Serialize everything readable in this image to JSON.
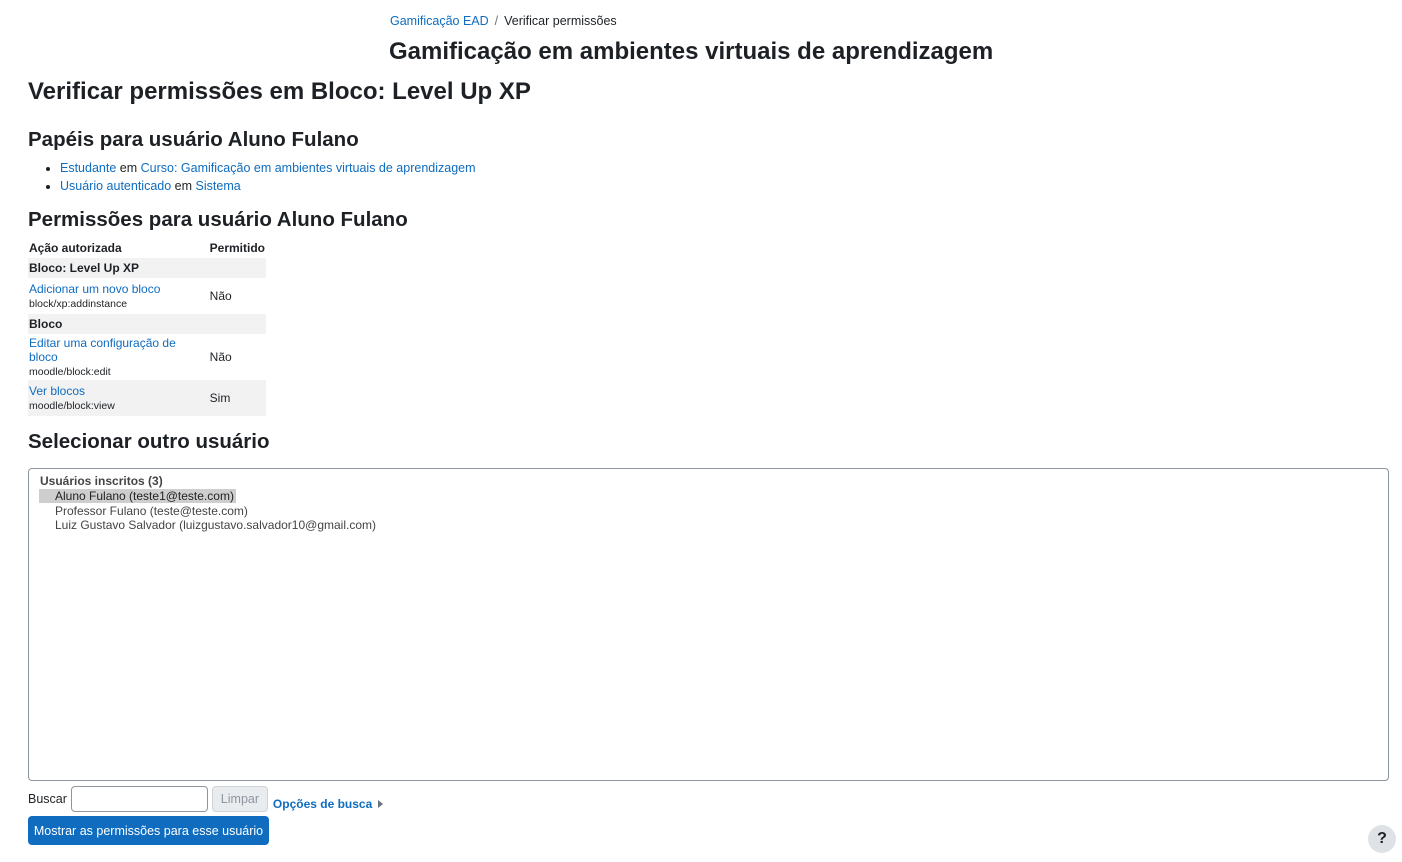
{
  "breadcrumb": {
    "course_link": "Gamificação EAD",
    "separator": "/",
    "current": "Verificar permissões"
  },
  "course_title": "Gamificação em ambientes virtuais de aprendizagem",
  "page_heading": "Verificar permissões em Bloco: Level Up XP",
  "roles": {
    "heading": "Papéis para usuário Aluno Fulano",
    "items": [
      {
        "role": "Estudante",
        "connector": "em",
        "context": "Curso: Gamificação em ambientes virtuais de aprendizagem"
      },
      {
        "role": "Usuário autenticado",
        "connector": "em",
        "context": "Sistema"
      }
    ]
  },
  "permissions": {
    "heading": "Permissões para usuário Aluno Fulano",
    "columns": [
      "Ação autorizada",
      "Permitido"
    ],
    "groups": [
      {
        "name": "Bloco: Level Up XP",
        "rows": [
          {
            "name": "Adicionar um novo bloco",
            "code": "block/xp:addinstance",
            "allowed": "Não"
          }
        ]
      },
      {
        "name": "Bloco",
        "rows": [
          {
            "name": "Editar uma configuração de bloco",
            "code": "moodle/block:edit",
            "allowed": "Não"
          },
          {
            "name": "Ver blocos",
            "code": "moodle/block:view",
            "allowed": "Sim"
          }
        ]
      }
    ]
  },
  "select_user": {
    "heading": "Selecionar outro usuário",
    "group_label": "Usuários inscritos (3)",
    "options": [
      {
        "label": "Aluno Fulano (teste1@teste.com)",
        "selected": true
      },
      {
        "label": "Professor Fulano (teste@teste.com)",
        "selected": false
      },
      {
        "label": "Luiz Gustavo Salvador (luizgustavo.salvador10@gmail.com)",
        "selected": false
      }
    ],
    "search_label": "Buscar",
    "search_value": "",
    "clear_label": "Limpar",
    "search_options_label": "Opções de busca",
    "submit_label": "Mostrar as permissões para esse usuário"
  },
  "help_label": "?",
  "colors": {
    "link": "#0f6cbf",
    "primary_button": "#0f6cbf",
    "selected_option": "#cecece",
    "group_row_bg": "#f2f2f2"
  }
}
